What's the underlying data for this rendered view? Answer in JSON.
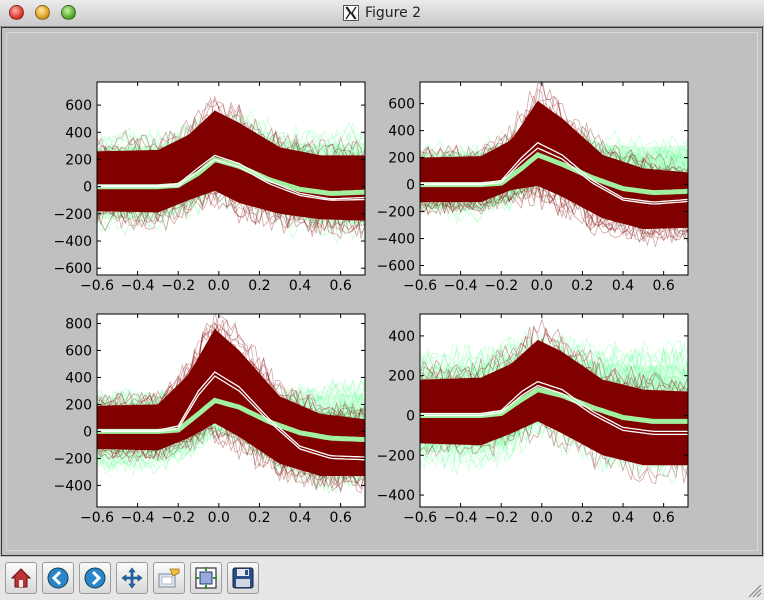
{
  "window": {
    "title": "Figure 2"
  },
  "toolbar": {
    "buttons": [
      {
        "name": "home",
        "icon": "home-icon",
        "tooltip": "Reset original view"
      },
      {
        "name": "back",
        "icon": "back-arrow-icon",
        "tooltip": "Back to previous view"
      },
      {
        "name": "forward",
        "icon": "forward-arrow-icon",
        "tooltip": "Forward to next view"
      },
      {
        "name": "pan",
        "icon": "move-icon",
        "tooltip": "Pan axes"
      },
      {
        "name": "zoom",
        "icon": "zoom-rect-icon",
        "tooltip": "Zoom to rectangle"
      },
      {
        "name": "subplots",
        "icon": "subplots-icon",
        "tooltip": "Configure subplots"
      },
      {
        "name": "save",
        "icon": "floppy-disk-icon",
        "tooltip": "Save the figure"
      }
    ]
  },
  "colors": {
    "red_traces": "#800000",
    "green_traces": "#66ff99",
    "green_mean": "#a0f0a0",
    "white_lines": "#ffffff"
  },
  "chart_data": [
    {
      "type": "line",
      "xlim": [
        -0.6,
        0.72
      ],
      "ylim": [
        -650,
        770
      ],
      "xticks": [
        "−0.6",
        "−0.4",
        "−0.2",
        "0.0",
        "0.2",
        "0.4",
        "0.6"
      ],
      "xtick_values": [
        -0.6,
        -0.4,
        -0.2,
        0.0,
        0.2,
        0.4,
        0.6
      ],
      "yticks": [
        "600",
        "400",
        "200",
        "0",
        "−200",
        "−400",
        "−600"
      ],
      "ytick_values": [
        600,
        400,
        200,
        0,
        -200,
        -400,
        -600
      ],
      "red_band": {
        "x": [
          -0.6,
          -0.3,
          -0.15,
          -0.02,
          0.1,
          0.3,
          0.5,
          0.72
        ],
        "upper": [
          260,
          270,
          380,
          560,
          470,
          290,
          230,
          230
        ],
        "lower": [
          -180,
          -190,
          -100,
          -30,
          -120,
          -200,
          -240,
          -250
        ]
      },
      "green_band": {
        "x": [
          -0.6,
          -0.3,
          -0.15,
          -0.02,
          0.1,
          0.3,
          0.5,
          0.72
        ],
        "upper": [
          290,
          300,
          380,
          440,
          460,
          330,
          310,
          320
        ],
        "lower": [
          -240,
          -240,
          -160,
          -20,
          -60,
          -200,
          -280,
          -280
        ]
      },
      "green_mean": {
        "x": [
          -0.6,
          -0.3,
          -0.2,
          -0.1,
          -0.02,
          0.1,
          0.25,
          0.4,
          0.55,
          0.72
        ],
        "y": [
          0,
          0,
          10,
          100,
          200,
          150,
          50,
          -20,
          -50,
          -40
        ]
      },
      "white_upper": {
        "x": [
          -0.6,
          -0.3,
          -0.2,
          -0.1,
          -0.02,
          0.1,
          0.25,
          0.4,
          0.55,
          0.72
        ],
        "y": [
          10,
          10,
          20,
          140,
          230,
          170,
          40,
          -50,
          -90,
          -80
        ]
      },
      "white_lower": {
        "x": [
          -0.6,
          -0.3,
          -0.2,
          -0.1,
          -0.02,
          0.1,
          0.25,
          0.4,
          0.55,
          0.72
        ],
        "y": [
          0,
          0,
          5,
          115,
          200,
          145,
          20,
          -65,
          -100,
          -95
        ]
      }
    },
    {
      "type": "line",
      "xlim": [
        -0.6,
        0.72
      ],
      "ylim": [
        -670,
        760
      ],
      "xticks": [
        "−0.6",
        "−0.4",
        "−0.2",
        "0.0",
        "0.2",
        "0.4",
        "0.6"
      ],
      "xtick_values": [
        -0.6,
        -0.4,
        -0.2,
        0.0,
        0.2,
        0.4,
        0.6
      ],
      "yticks": [
        "600",
        "400",
        "200",
        "0",
        "−200",
        "−400",
        "−600"
      ],
      "yticks_values_note": "",
      "ytick_values": [
        600,
        400,
        200,
        0,
        -200,
        -400,
        -600
      ],
      "red_band": {
        "x": [
          -0.6,
          -0.3,
          -0.15,
          -0.02,
          0.1,
          0.3,
          0.5,
          0.72
        ],
        "upper": [
          200,
          210,
          330,
          620,
          490,
          220,
          120,
          90
        ],
        "lower": [
          -130,
          -130,
          -40,
          -10,
          -90,
          -250,
          -330,
          -320
        ]
      },
      "green_band": {
        "x": [
          -0.6,
          -0.3,
          -0.15,
          -0.02,
          0.1,
          0.3,
          0.5,
          0.72
        ],
        "upper": [
          240,
          240,
          330,
          440,
          420,
          300,
          280,
          290
        ],
        "lower": [
          -180,
          -190,
          -110,
          -10,
          -40,
          -180,
          -250,
          -260
        ]
      },
      "green_mean": {
        "x": [
          -0.6,
          -0.3,
          -0.2,
          -0.1,
          -0.02,
          0.1,
          0.25,
          0.4,
          0.55,
          0.72
        ],
        "y": [
          0,
          0,
          10,
          120,
          220,
          150,
          50,
          -30,
          -60,
          -50
        ]
      },
      "white_upper": {
        "x": [
          -0.6,
          -0.3,
          -0.2,
          -0.1,
          -0.02,
          0.1,
          0.25,
          0.4,
          0.55,
          0.72
        ],
        "y": [
          10,
          10,
          30,
          200,
          310,
          220,
          30,
          -100,
          -130,
          -110
        ]
      },
      "white_lower": {
        "x": [
          -0.6,
          -0.3,
          -0.2,
          -0.1,
          -0.02,
          0.1,
          0.25,
          0.4,
          0.55,
          0.72
        ],
        "y": [
          0,
          0,
          15,
          170,
          270,
          190,
          10,
          -115,
          -145,
          -125
        ]
      }
    },
    {
      "type": "line",
      "xlim": [
        -0.6,
        0.72
      ],
      "ylim": [
        -560,
        870
      ],
      "xticks": [
        "−0.6",
        "−0.4",
        "−0.2",
        "0.0",
        "0.2",
        "0.4",
        "0.6"
      ],
      "xtick_values": [
        -0.6,
        -0.4,
        -0.2,
        0.0,
        0.2,
        0.4,
        0.6
      ],
      "yticks": [
        "800",
        "600",
        "400",
        "200",
        "0",
        "−200",
        "−400"
      ],
      "ytick_values": [
        800,
        600,
        400,
        200,
        0,
        -200,
        -400
      ],
      "red_band": {
        "x": [
          -0.6,
          -0.3,
          -0.15,
          -0.02,
          0.1,
          0.3,
          0.5,
          0.72
        ],
        "upper": [
          190,
          200,
          420,
          760,
          600,
          260,
          130,
          90
        ],
        "lower": [
          -130,
          -140,
          -50,
          60,
          -40,
          -240,
          -330,
          -330
        ]
      },
      "green_band": {
        "x": [
          -0.6,
          -0.3,
          -0.15,
          -0.02,
          0.1,
          0.3,
          0.5,
          0.72
        ],
        "upper": [
          220,
          220,
          300,
          320,
          300,
          240,
          260,
          280
        ],
        "lower": [
          -200,
          -200,
          -130,
          20,
          -20,
          -200,
          -300,
          -300
        ]
      },
      "green_mean": {
        "x": [
          -0.6,
          -0.3,
          -0.2,
          -0.1,
          -0.02,
          0.1,
          0.25,
          0.4,
          0.55,
          0.72
        ],
        "y": [
          0,
          0,
          10,
          130,
          230,
          180,
          70,
          -10,
          -50,
          -60
        ]
      },
      "white_upper": {
        "x": [
          -0.6,
          -0.3,
          -0.2,
          -0.1,
          -0.02,
          0.1,
          0.25,
          0.4,
          0.55,
          0.72
        ],
        "y": [
          10,
          10,
          40,
          300,
          440,
          330,
          90,
          -110,
          -180,
          -190
        ]
      },
      "white_lower": {
        "x": [
          -0.6,
          -0.3,
          -0.2,
          -0.1,
          -0.02,
          0.1,
          0.25,
          0.4,
          0.55,
          0.72
        ],
        "y": [
          0,
          0,
          20,
          270,
          410,
          300,
          70,
          -130,
          -200,
          -210
        ]
      }
    },
    {
      "type": "line",
      "xlim": [
        -0.6,
        0.72
      ],
      "ylim": [
        -460,
        510
      ],
      "xticks": [
        "−0.6",
        "−0.4",
        "−0.2",
        "0.0",
        "0.2",
        "0.4",
        "0.6"
      ],
      "xtick_values": [
        -0.6,
        -0.4,
        -0.2,
        0.0,
        0.2,
        0.4,
        0.6
      ],
      "yticks": [
        "400",
        "200",
        "0",
        "−200",
        "−400"
      ],
      "ytick_values": [
        400,
        200,
        0,
        -200,
        -400
      ],
      "red_band": {
        "x": [
          -0.6,
          -0.3,
          -0.15,
          -0.02,
          0.1,
          0.3,
          0.5,
          0.72
        ],
        "upper": [
          180,
          190,
          260,
          380,
          320,
          180,
          130,
          120
        ],
        "lower": [
          -140,
          -150,
          -90,
          -30,
          -90,
          -200,
          -250,
          -250
        ]
      },
      "green_band": {
        "x": [
          -0.6,
          -0.3,
          -0.15,
          -0.02,
          0.1,
          0.3,
          0.5,
          0.72
        ],
        "upper": [
          240,
          250,
          300,
          330,
          310,
          260,
          250,
          250
        ],
        "lower": [
          -180,
          -190,
          -140,
          -40,
          -80,
          -180,
          -210,
          -210
        ]
      },
      "green_mean": {
        "x": [
          -0.6,
          -0.3,
          -0.2,
          -0.1,
          -0.02,
          0.1,
          0.25,
          0.4,
          0.55,
          0.72
        ],
        "y": [
          0,
          0,
          10,
          80,
          130,
          100,
          40,
          -10,
          -30,
          -30
        ]
      },
      "white_upper": {
        "x": [
          -0.6,
          -0.3,
          -0.2,
          -0.1,
          -0.02,
          0.1,
          0.25,
          0.4,
          0.55,
          0.72
        ],
        "y": [
          10,
          10,
          25,
          120,
          170,
          130,
          20,
          -60,
          -80,
          -80
        ]
      },
      "white_lower": {
        "x": [
          -0.6,
          -0.3,
          -0.2,
          -0.1,
          -0.02,
          0.1,
          0.25,
          0.4,
          0.55,
          0.72
        ],
        "y": [
          0,
          0,
          15,
          100,
          150,
          110,
          5,
          -75,
          -95,
          -95
        ]
      }
    }
  ]
}
